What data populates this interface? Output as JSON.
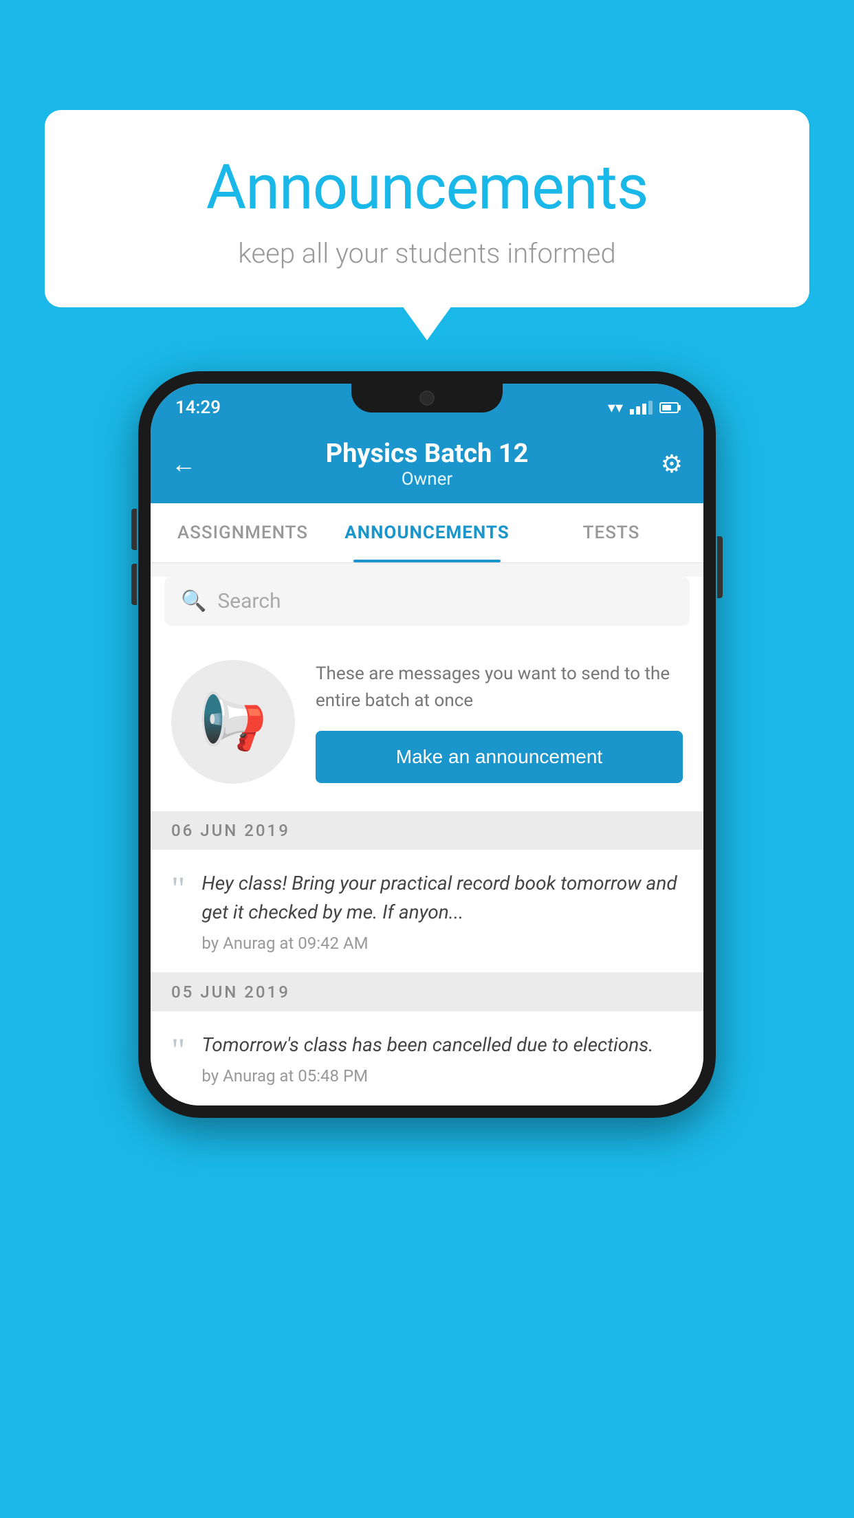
{
  "background_color": "#1ab8e8",
  "speech_bubble": {
    "title": "Announcements",
    "subtitle": "keep all your students informed"
  },
  "phone": {
    "status_bar": {
      "time": "14:29"
    },
    "header": {
      "title": "Physics Batch 12",
      "subtitle": "Owner",
      "back_label": "←",
      "settings_label": "⚙"
    },
    "tabs": [
      {
        "label": "ASSIGNMENTS",
        "active": false
      },
      {
        "label": "ANNOUNCEMENTS",
        "active": true
      },
      {
        "label": "TESTS",
        "active": false
      }
    ],
    "search": {
      "placeholder": "Search"
    },
    "promo": {
      "description": "These are messages you want to send to the entire batch at once",
      "button_label": "Make an announcement"
    },
    "announcements": [
      {
        "date": "06  JUN  2019",
        "text": "Hey class! Bring your practical record book tomorrow and get it checked by me. If anyon...",
        "author": "by Anurag at 09:42 AM"
      },
      {
        "date": "05  JUN  2019",
        "text": "Tomorrow's class has been cancelled due to elections.",
        "author": "by Anurag at 05:48 PM"
      }
    ]
  }
}
